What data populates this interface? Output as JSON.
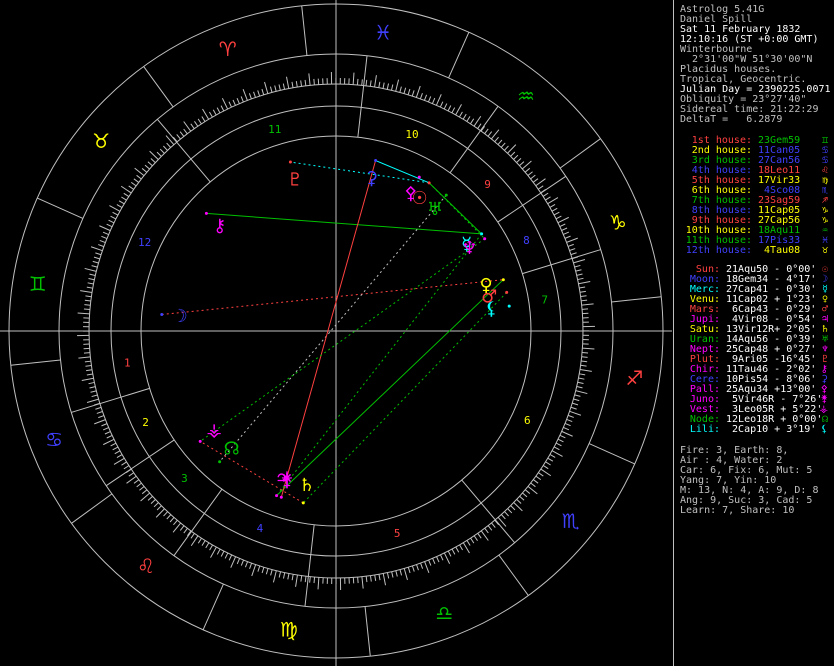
{
  "window": {
    "title": "Astrolog 5.41G"
  },
  "colors": {
    "fire": "#ff4040",
    "earth": "#ffff00",
    "air": "#00c000",
    "water": "#4040ff",
    "grey": "#c0c0c0",
    "cyan": "#00ffff",
    "magenta": "#ff00ff",
    "white": "#ffffff"
  },
  "header": [
    {
      "text": "Astrolog 5.41G",
      "color": "#c0c0c0"
    },
    {
      "text": "Daniel Spill",
      "color": "#c0c0c0"
    },
    {
      "text": "Sat 11 February 1832",
      "color": "#ffffff"
    },
    {
      "text": "12:10:16 (ST +0:00 GMT)",
      "color": "#ffffff"
    },
    {
      "text": "Winterbourne",
      "color": "#c0c0c0"
    },
    {
      "text": "  2°31'00\"W 51°30'00\"N",
      "color": "#c0c0c0"
    },
    {
      "text": "Placidus houses.",
      "color": "#c0c0c0"
    },
    {
      "text": "Tropical, Geocentric.",
      "color": "#c0c0c0"
    },
    {
      "text": "Julian Day = 2390225.0071",
      "color": "#ffffff"
    },
    {
      "text": "Obliquity = 23°27'40\"",
      "color": "#c0c0c0"
    },
    {
      "text": "Sidereal time: 21:22:29",
      "color": "#c0c0c0"
    },
    {
      "text": "DeltaT =   6.2879",
      "color": "#c0c0c0"
    }
  ],
  "houses": [
    {
      "label": "1st house:",
      "value": "23Gem59",
      "color": "#ff4040",
      "valcolor": "#00c000",
      "glyph": "♊"
    },
    {
      "label": "2nd house:",
      "value": "11Can05",
      "color": "#ffff00",
      "valcolor": "#4040ff",
      "glyph": "♋"
    },
    {
      "label": "3rd house:",
      "value": "27Can56",
      "color": "#00c000",
      "valcolor": "#4040ff",
      "glyph": "♋"
    },
    {
      "label": "4th house:",
      "value": "18Leo11",
      "color": "#4040ff",
      "valcolor": "#ff4040",
      "glyph": "♌"
    },
    {
      "label": "5th house:",
      "value": "17Vir33",
      "color": "#ff4040",
      "valcolor": "#ffff00",
      "glyph": "♍"
    },
    {
      "label": "6th house:",
      "value": " 4Sco08",
      "color": "#ffff00",
      "valcolor": "#4040ff",
      "glyph": "♏"
    },
    {
      "label": "7th house:",
      "value": "23Sag59",
      "color": "#00c000",
      "valcolor": "#ff4040",
      "glyph": "♐"
    },
    {
      "label": "8th house:",
      "value": "11Cap05",
      "color": "#4040ff",
      "valcolor": "#ffff00",
      "glyph": "♑"
    },
    {
      "label": "9th house:",
      "value": "27Cap56",
      "color": "#ff4040",
      "valcolor": "#ffff00",
      "glyph": "♑"
    },
    {
      "label": "10th house:",
      "value": "18Aqu11",
      "color": "#ffff00",
      "valcolor": "#00c000",
      "glyph": "♒"
    },
    {
      "label": "11th house:",
      "value": "17Pis33",
      "color": "#00c000",
      "valcolor": "#4040ff",
      "glyph": "♓"
    },
    {
      "label": "12th house:",
      "value": " 4Tau08",
      "color": "#4040ff",
      "valcolor": "#ffff00",
      "glyph": "♉"
    }
  ],
  "planets": [
    {
      "name": "Sun:",
      "pos": "21Aqu50",
      "lat": " - 0°00'",
      "color": "#ff4040",
      "glyph": "☉"
    },
    {
      "name": "Moon:",
      "pos": "18Gem34",
      "lat": " - 4°17'",
      "color": "#4040ff",
      "glyph": "☽"
    },
    {
      "name": "Merc:",
      "pos": "27Cap41",
      "lat": " - 0°30'",
      "color": "#00ffff",
      "glyph": "☿"
    },
    {
      "name": "Venu:",
      "pos": "11Cap02",
      "lat": " + 1°23'",
      "color": "#ffff00",
      "glyph": "♀"
    },
    {
      "name": "Mars:",
      "pos": " 6Cap43",
      "lat": " - 0°29'",
      "color": "#ff4040",
      "glyph": "♂"
    },
    {
      "name": "Jupi:",
      "pos": " 4Vir08",
      "lat": " - 0°54'",
      "color": "#ff00ff",
      "glyph": "♃"
    },
    {
      "name": "Satu:",
      "pos": "13Vir12R",
      "lat": "+ 2°05'",
      "color": "#ffff00",
      "glyph": "♄"
    },
    {
      "name": "Uran:",
      "pos": "14Aqu56",
      "lat": " - 0°39'",
      "color": "#00c000",
      "glyph": "♅"
    },
    {
      "name": "Nept:",
      "pos": "25Cap48",
      "lat": " + 0°27'",
      "color": "#ff00ff",
      "glyph": "♆"
    },
    {
      "name": "Plut:",
      "pos": " 9Ari05",
      "lat": " -16°45'",
      "color": "#ff4040",
      "glyph": "♇"
    },
    {
      "name": "Chir:",
      "pos": "11Tau46",
      "lat": " - 2°02'",
      "color": "#ff00ff",
      "glyph": "⚷"
    },
    {
      "name": "Cere:",
      "pos": "10Pis54",
      "lat": " - 8°06'",
      "color": "#4040ff",
      "glyph": "⚳"
    },
    {
      "name": "Pall:",
      "pos": "25Aqu34",
      "lat": " +13°00'",
      "color": "#ff00ff",
      "glyph": "⚴"
    },
    {
      "name": "Juno:",
      "pos": " 5Vir46R",
      "lat": " - 7°26'",
      "color": "#ff00ff",
      "glyph": "⚵"
    },
    {
      "name": "Vest:",
      "pos": " 3Leo05R",
      "lat": " + 5°22'",
      "color": "#ff00ff",
      "glyph": "⚶"
    },
    {
      "name": "Node:",
      "pos": "12Leo18R",
      "lat": " + 0°00'",
      "color": "#00c000",
      "glyph": "☊"
    },
    {
      "name": "Lili:",
      "pos": " 2Cap10",
      "lat": " + 3°19'",
      "color": "#00ffff",
      "glyph": "⚸"
    }
  ],
  "summary": [
    "Fire: 3, Earth: 8,",
    "Air : 4, Water: 2",
    "Car: 6, Fix: 6, Mut: 5",
    "Yang: 7, Yin: 10",
    "M: 13, N: 4, A: 9, D: 8",
    "Ang: 9, Suc: 3, Cad: 5",
    "Learn: 7, Share: 10"
  ],
  "wheel": {
    "ascendant_deg": 83.98,
    "signs": [
      {
        "glyph": "♈",
        "color": "#ff4040"
      },
      {
        "glyph": "♉",
        "color": "#ffff00"
      },
      {
        "glyph": "♊",
        "color": "#00c000"
      },
      {
        "glyph": "♋",
        "color": "#4040ff"
      },
      {
        "glyph": "♌",
        "color": "#ff4040"
      },
      {
        "glyph": "♍",
        "color": "#ffff00"
      },
      {
        "glyph": "♎",
        "color": "#00c000"
      },
      {
        "glyph": "♏",
        "color": "#4040ff"
      },
      {
        "glyph": "♐",
        "color": "#ff4040"
      },
      {
        "glyph": "♑",
        "color": "#ffff00"
      },
      {
        "glyph": "♒",
        "color": "#00c000"
      },
      {
        "glyph": "♓",
        "color": "#4040ff"
      }
    ],
    "house_cusps_deg": [
      83.98,
      101.08,
      117.93,
      138.18,
      167.55,
      214.13,
      263.98,
      281.08,
      297.93,
      318.18,
      347.55,
      34.13
    ],
    "planet_positions_deg": [
      321.83,
      78.57,
      297.68,
      281.03,
      276.72,
      154.13,
      163.2,
      314.93,
      295.8,
      9.08,
      41.77,
      340.9,
      325.57,
      155.77,
      123.08,
      132.3,
      272.17
    ]
  }
}
